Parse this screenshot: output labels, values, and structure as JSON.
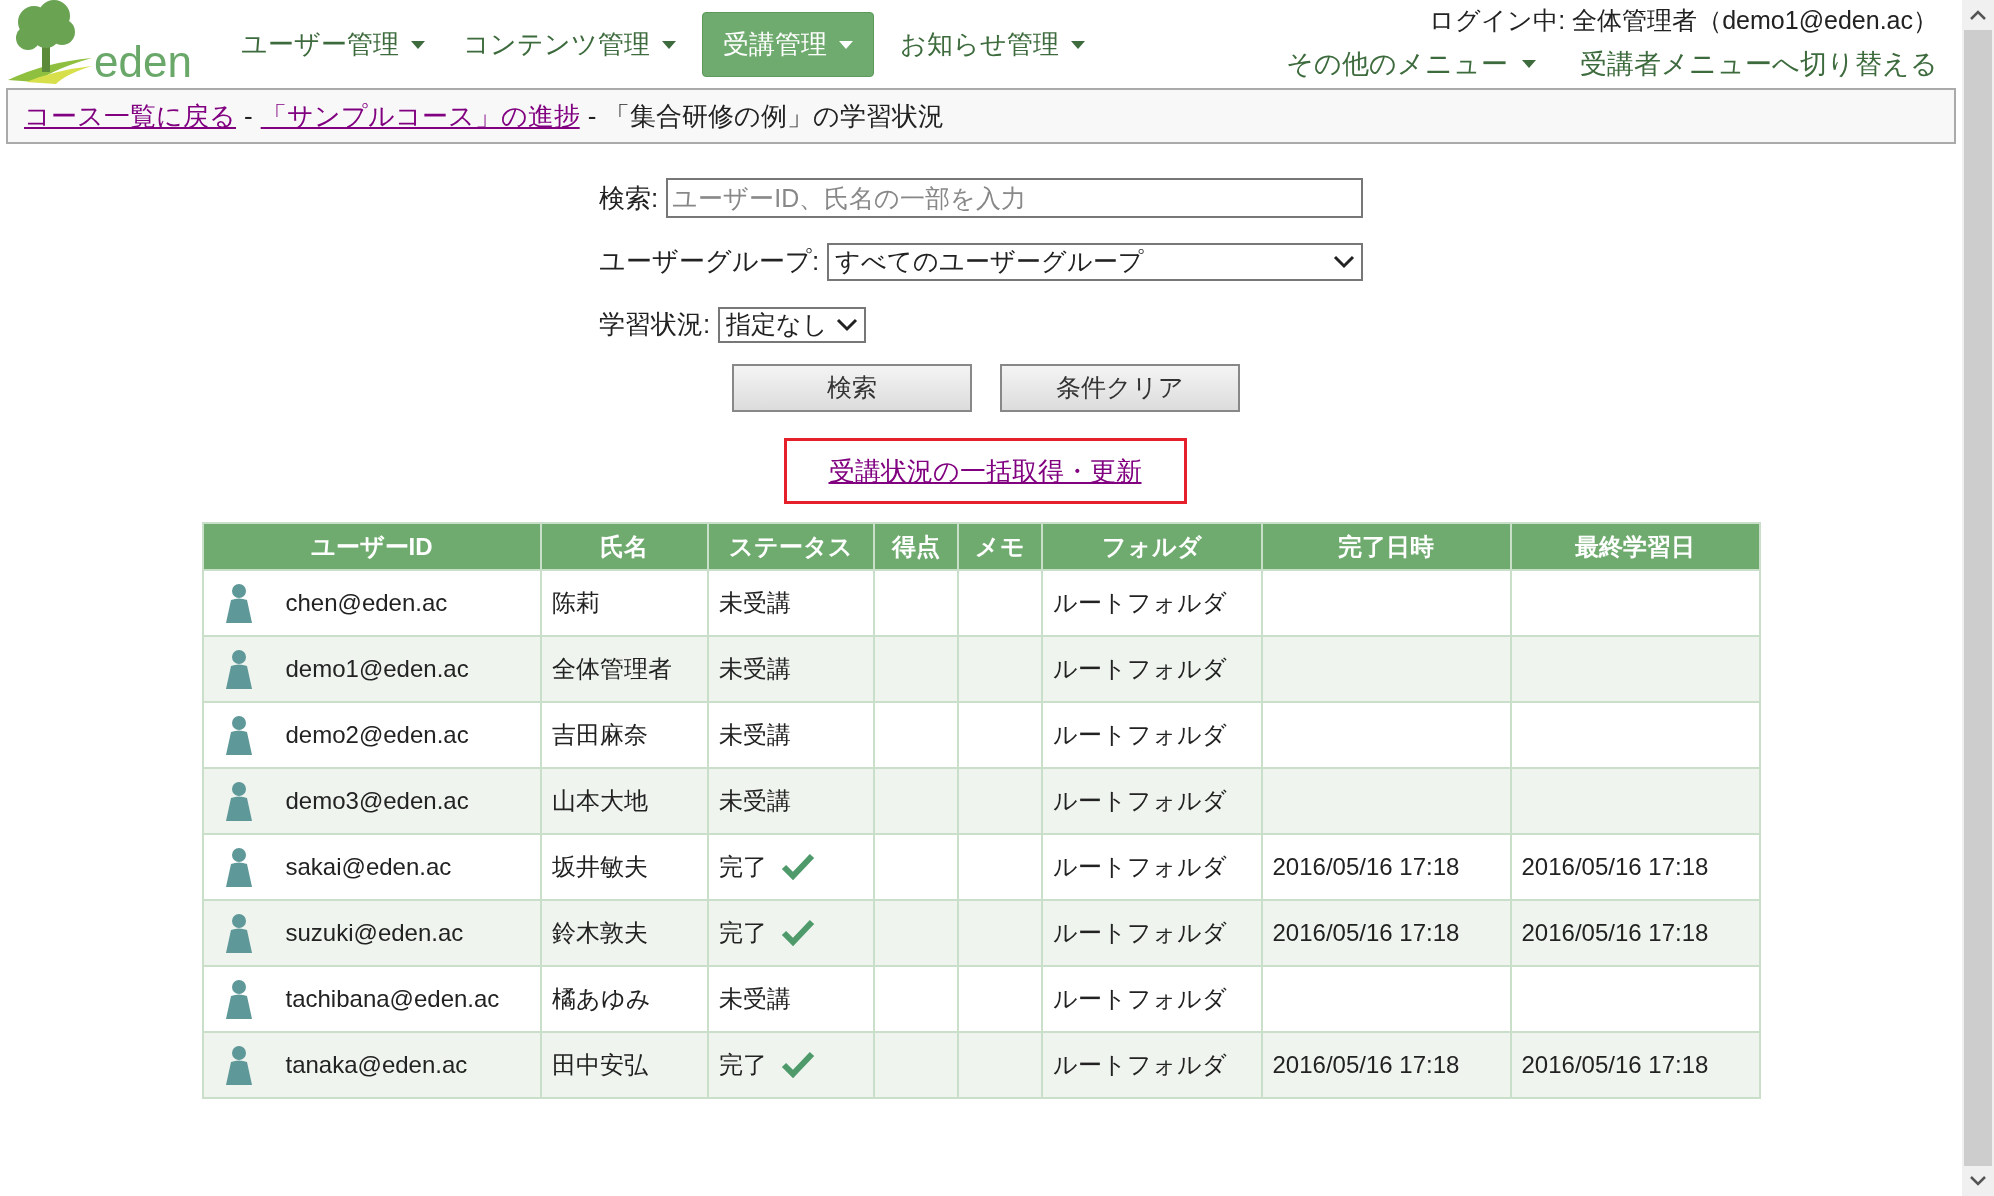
{
  "logo": {
    "text": "eden"
  },
  "nav": [
    {
      "label": "ユーザー管理",
      "selected": false
    },
    {
      "label": "コンテンツ管理",
      "selected": false
    },
    {
      "label": "受講管理",
      "selected": true
    },
    {
      "label": "お知らせ管理",
      "selected": false
    }
  ],
  "login_status": "ログイン中: 全体管理者（demo1@eden.ac）",
  "user_menu": [
    {
      "kind": "dropdown",
      "label": "その他のメニュー"
    },
    {
      "kind": "link",
      "label": "受講者メニューへ切り替える"
    }
  ],
  "breadcrumb": [
    {
      "kind": "link",
      "label": "コース一覧に戻る"
    },
    {
      "kind": "separator",
      "label": "-"
    },
    {
      "kind": "link",
      "label": "「サンプルコース」の進捗"
    },
    {
      "kind": "separator",
      "label": "-"
    },
    {
      "kind": "text",
      "label": "「集合研修の例」の学習状況"
    }
  ],
  "search": {
    "label": "検索:",
    "placeholder": "ユーザーID、氏名の一部を入力"
  },
  "user_group": {
    "label": "ユーザーグループ:",
    "value": "すべてのユーザーグループ"
  },
  "study_status": {
    "label": "学習状況:",
    "value": "指定なし"
  },
  "buttons": [
    "検索",
    "条件クリア"
  ],
  "bulk_update_link": "受講状況の一括取得・更新",
  "table": {
    "columns": [
      "ユーザーID",
      "氏名",
      "ステータス",
      "得点",
      "メモ",
      "フォルダ",
      "完了日時",
      "最終学習日"
    ],
    "rows": [
      {
        "user_id": "chen@eden.ac",
        "name": "陈莉",
        "status": "未受講",
        "completed": false,
        "folder": "ルートフォルダ"
      },
      {
        "user_id": "demo1@eden.ac",
        "name": "全体管理者",
        "status": "未受講",
        "completed": false,
        "folder": "ルートフォルダ"
      },
      {
        "user_id": "demo2@eden.ac",
        "name": "吉田麻奈",
        "status": "未受講",
        "completed": false,
        "folder": "ルートフォルダ"
      },
      {
        "user_id": "demo3@eden.ac",
        "name": "山本大地",
        "status": "未受講",
        "completed": false,
        "folder": "ルートフォルダ"
      },
      {
        "user_id": "sakai@eden.ac",
        "name": "坂井敏夫",
        "status": "完了",
        "completed": true,
        "folder": "ルートフォルダ",
        "completed_at": "2016/05/16 17:18",
        "last_study": "2016/05/16 17:18"
      },
      {
        "user_id": "suzuki@eden.ac",
        "name": "鈴木敦夫",
        "status": "完了",
        "completed": true,
        "folder": "ルートフォルダ",
        "completed_at": "2016/05/16 17:18",
        "last_study": "2016/05/16 17:18"
      },
      {
        "user_id": "tachibana@eden.ac",
        "name": "橘あゆみ",
        "status": "未受講",
        "completed": false,
        "folder": "ルートフォルダ"
      },
      {
        "user_id": "tanaka@eden.ac",
        "name": "田中安弘",
        "status": "完了",
        "completed": true,
        "folder": "ルートフォルダ",
        "completed_at": "2016/05/16 17:18",
        "last_study": "2016/05/16 17:18"
      }
    ]
  }
}
